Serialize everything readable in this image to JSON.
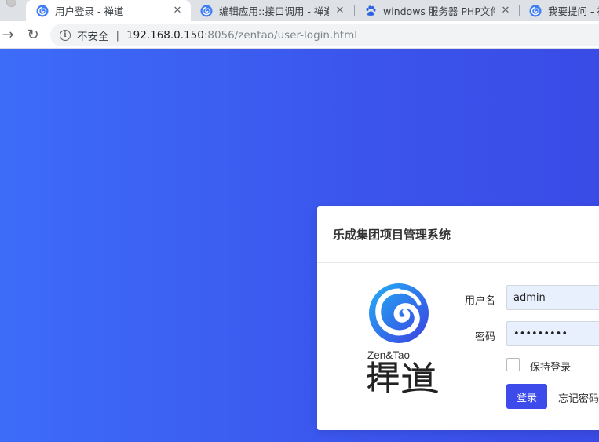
{
  "browser": {
    "tabs": [
      {
        "title": "用户登录 - 禅道",
        "active": true,
        "favicon": "zentao-icon",
        "close": "✕"
      },
      {
        "title": "编辑应用::接口调用 - 禅道",
        "active": false,
        "favicon": "zentao-icon",
        "close": "✕"
      },
      {
        "title": "windows 服务器 PHP文件",
        "active": false,
        "favicon": "baidu-paw-icon",
        "close": "✕"
      },
      {
        "title": "我要提问 - 禅",
        "active": false,
        "favicon": "zentao-icon",
        "close": ""
      }
    ],
    "toolbar": {
      "back_icon": "→",
      "reload_icon": "↻",
      "security_label": "不安全",
      "url_host": "192.168.0.150",
      "url_rest": ":8056/zentao/user-login.html"
    }
  },
  "login": {
    "title": "乐成集团项目管理系统",
    "logo_text": "Zen&Tao",
    "username_label": "用户名",
    "username_value": "admin",
    "password_label": "密码",
    "password_value": "•••••••••",
    "remember_label": "保持登录",
    "remember_checked": false,
    "login_button": "登录",
    "forgot_link": "忘记密码"
  },
  "colors": {
    "background_start": "#3d6cf9",
    "background_end": "#3a4be6",
    "button": "#3c4bea",
    "input_fill": "#e8f0fe"
  }
}
